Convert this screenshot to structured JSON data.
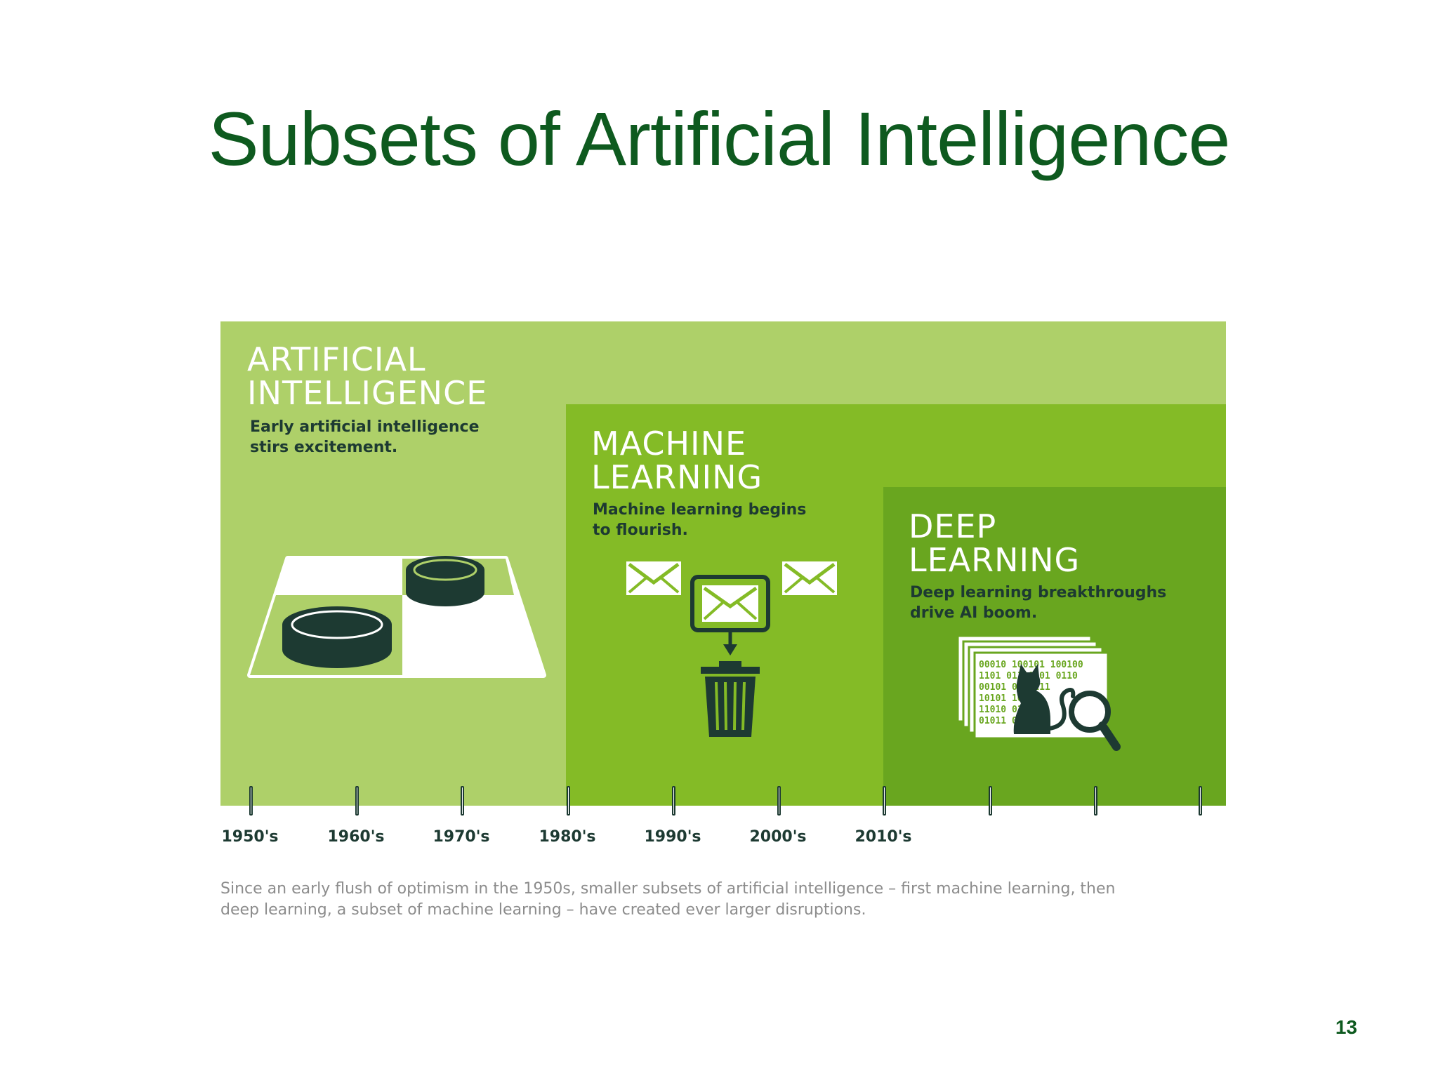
{
  "slide": {
    "title": "Subsets of Artificial Intelligence",
    "page_number": "13"
  },
  "panels": {
    "ai": {
      "heading": "ARTIFICIAL\nINTELLIGENCE",
      "subtitle": "Early artificial intelligence\nstirs excitement.",
      "color": "#aed069"
    },
    "ml": {
      "heading": "MACHINE\nLEARNING",
      "subtitle": "Machine learning begins\nto flourish.",
      "color": "#84bb26"
    },
    "dl": {
      "heading": "DEEP\nLEARNING",
      "subtitle": "Deep learning breakthroughs\ndrive AI boom.",
      "color": "#69a61f"
    }
  },
  "timeline": {
    "years": [
      "1950's",
      "1960's",
      "1970's",
      "1980's",
      "1990's",
      "2000's",
      "2010's"
    ],
    "tick_count": 10
  },
  "binary_text": {
    "line1": "00010 100101  100100",
    "line2": "1101  01110 01 0110",
    "line3": "00101      0010111",
    "line4": "10101       1010",
    "line5": "11010       01",
    "line6": "01011        010101"
  },
  "caption": "Since an early flush of optimism in the 1950s, smaller subsets of artificial intelligence – first machine learning, then\ndeep learning, a subset of machine learning – have created ever larger disruptions.",
  "icons": {
    "ai": "checkers-board-icon",
    "ml": "email-spam-filter-icon",
    "dl": "cat-recognition-magnifier-icon"
  },
  "colors": {
    "title": "#0e5a1f",
    "dark": "#1d3a32",
    "caption": "#8c8c8c"
  }
}
